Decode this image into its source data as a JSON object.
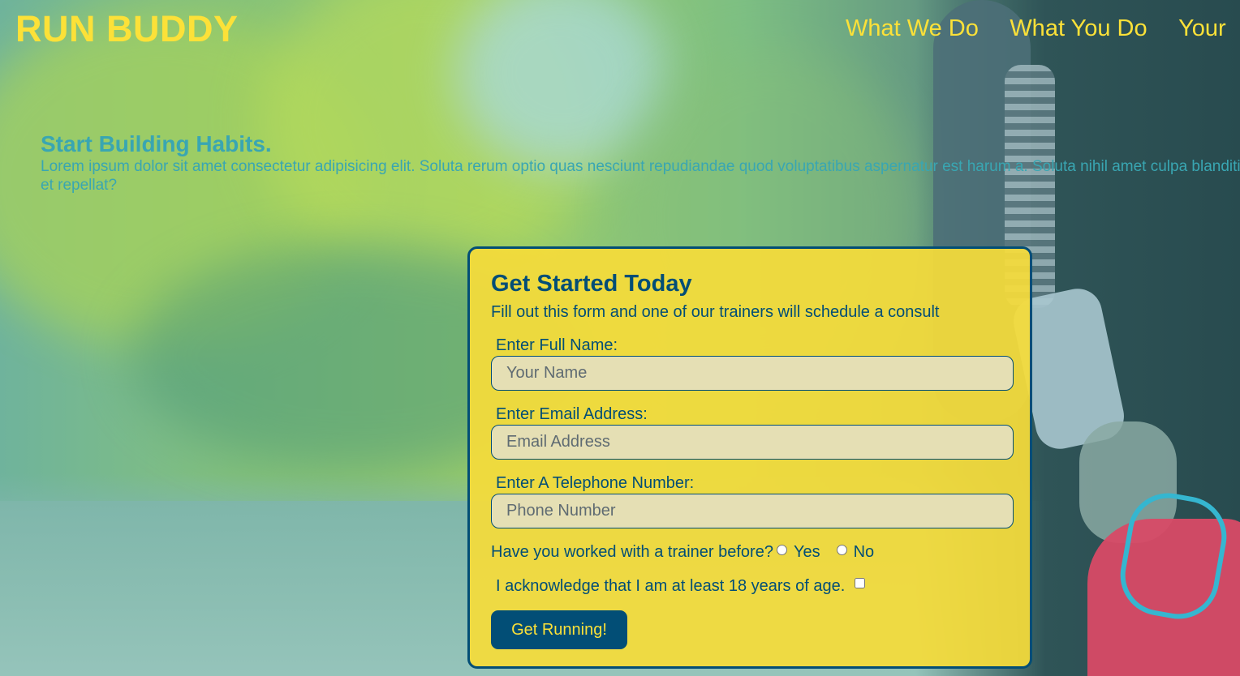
{
  "header": {
    "logo": "RUN BUDDY",
    "nav": [
      "What We Do",
      "What You Do",
      "Your"
    ]
  },
  "hero": {
    "title": "Start Building Habits.",
    "text": "Lorem ipsum dolor sit amet consectetur adipisicing elit. Soluta rerum optio quas nesciunt repudiandae quod voluptatibus aspernatur est harum a. Soluta nihil amet culpa blanditiis, et repellat?"
  },
  "form": {
    "title": "Get Started Today",
    "subtitle": "Fill out this form and one of our trainers will schedule a consult",
    "name_label": "Enter Full Name:",
    "name_placeholder": "Your Name",
    "email_label": "Enter Email Address:",
    "email_placeholder": "Email Address",
    "phone_label": "Enter A Telephone Number:",
    "phone_placeholder": "Phone Number",
    "trainer_question": "Have you worked with a trainer before?",
    "yes_label": "Yes",
    "no_label": "No",
    "age_ack": "I acknowledge that I am at least 18 years of age.",
    "submit_label": "Get Running!"
  },
  "colors": {
    "accent_yellow": "#fce138",
    "primary_blue": "#024e76",
    "hero_teal": "#39a6b2"
  }
}
